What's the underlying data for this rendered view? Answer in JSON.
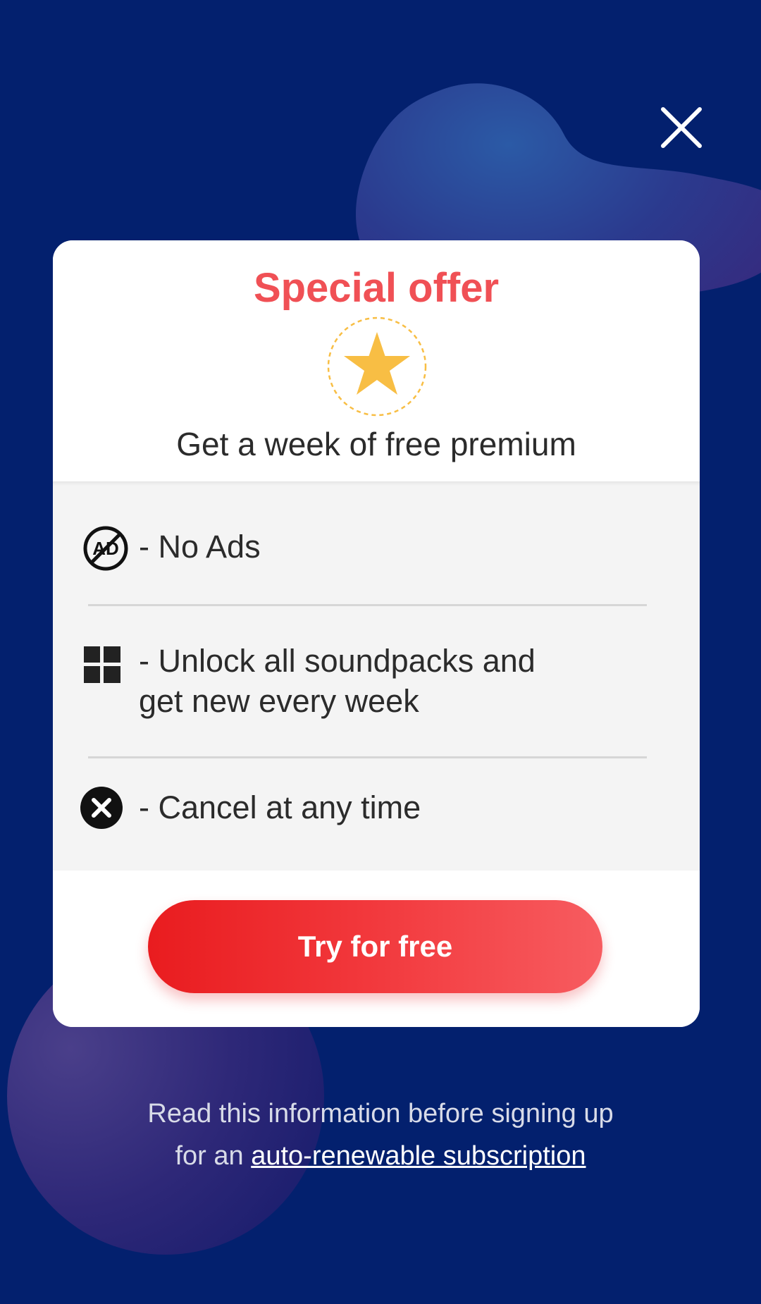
{
  "colors": {
    "background": "#03206e",
    "accent_red": "#f05055",
    "star": "#f8be44",
    "card": "#ffffff",
    "features_bg": "#f4f4f4"
  },
  "close_icon": "close-icon",
  "offer": {
    "title": "Special offer",
    "badge_icon": "star-icon",
    "subtitle": "Get a week of free premium"
  },
  "features": [
    {
      "icon": "no-ads-icon",
      "text": "- No Ads"
    },
    {
      "icon": "grid-icon",
      "text": "- Unlock all soundpacks and\n  get new every week"
    },
    {
      "icon": "cancel-circle-icon",
      "text": "- Cancel at any time"
    }
  ],
  "cta": {
    "label": "Try for free"
  },
  "disclaimer": {
    "line1": "Read this information before signing up",
    "line2_prefix": "for an ",
    "link": "auto-renewable subscription"
  }
}
